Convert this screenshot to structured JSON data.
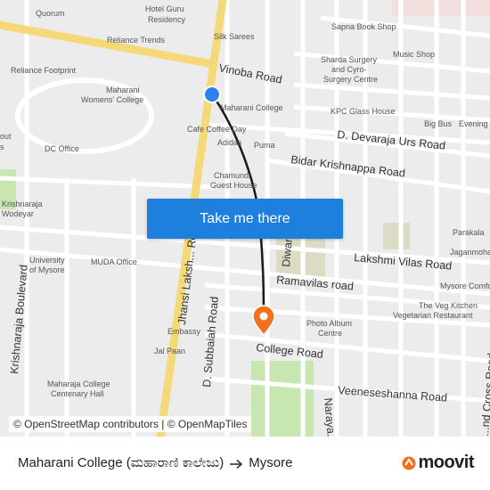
{
  "map": {
    "roads": {
      "vinoba": "Vinoba Road",
      "devaraja": "D. Devaraja Urs Road",
      "bidar": "Bidar Krishnappa Road",
      "lakshmi_vilas": "Lakshmi Vilas Road",
      "ramavilas": "Ramavilas road",
      "college": "College Road",
      "veeneseshanna": "Veeneseshanna Road",
      "jhansi": "Jhansi Laksh... Road",
      "subbaiah": "D. Subbaiah Road",
      "diwans": "Diwan's Ro...",
      "krishnaraja_blvd": "Krishnaraja Boulevard",
      "narayan": "Naraya...",
      "cross": "...nd Cross Road"
    },
    "pois": {
      "quorum": "Quorum",
      "hotel_guru_1": "Hotel Guru",
      "hotel_guru_2": "Residency",
      "reliance_trends": "Reliance Trends",
      "silk_sarees": "Silk Sarees",
      "sapna": "Sapna Book Shop",
      "music_shop": "Music Shop",
      "sharda_1": "Sharda Surgery",
      "sharda_2": "and Cyro-",
      "sharda_3": "Surgery Centre",
      "reliance_footprint": "Reliance Footprint",
      "maharani_wc_1": "Maharani",
      "maharani_wc_2": "Womens' College",
      "maharani_college": "Maharani College",
      "kpc": "KPC Glass House",
      "big_bus": "Big Bus",
      "evening": "Evening",
      "cafe_coffee": "Cafe Coffee Day",
      "adidas": "Adidas",
      "puma": "Puma",
      "dc_office": "DC Office",
      "chamundi_1": "Chamundi",
      "chamundi_2": "Guest House",
      "krishnaraja_1": "Krishnaraja",
      "krishnaraja_2": "Wodeyar",
      "parakala": "Parakala",
      "jaganmohana": "Jaganmohan",
      "university_1": "University",
      "university_2": "of Mysore",
      "muda": "MUDA Office",
      "mysore_comfort": "Mysore Comfo",
      "veg_kitchen_1": "The Veg Kitchen",
      "veg_kitchen_2": "Vegetarian Restaurant",
      "photo_album_1": "Photo Album",
      "photo_album_2": "Centre",
      "embassy": "Embassy",
      "jal_paan": "Jal Paan",
      "maharaja_1": "Maharaja College",
      "maharaja_2": "Centenary Hall",
      "out_1": "out",
      "out_2": "s"
    },
    "colors": {
      "origin_marker": "#2f80ed",
      "destination_marker": "#f2711c",
      "route_line": "#1a1a1a",
      "main_road": "#f5d979",
      "park": "#c8e6b0"
    }
  },
  "cta": {
    "label": "Take me there"
  },
  "attribution": {
    "part1": "© OpenStreetMap contributors",
    "separator": " | ",
    "part2": "© OpenMapTiles"
  },
  "footer": {
    "origin": "Maharani College (ಮಹಾರಾಣಿ ಕಾಲೇಜು)",
    "destination": "Mysore",
    "brand": "moovit",
    "arrow_icon": "arrow-right-icon",
    "brand_icon": "moovit-pin-icon"
  }
}
